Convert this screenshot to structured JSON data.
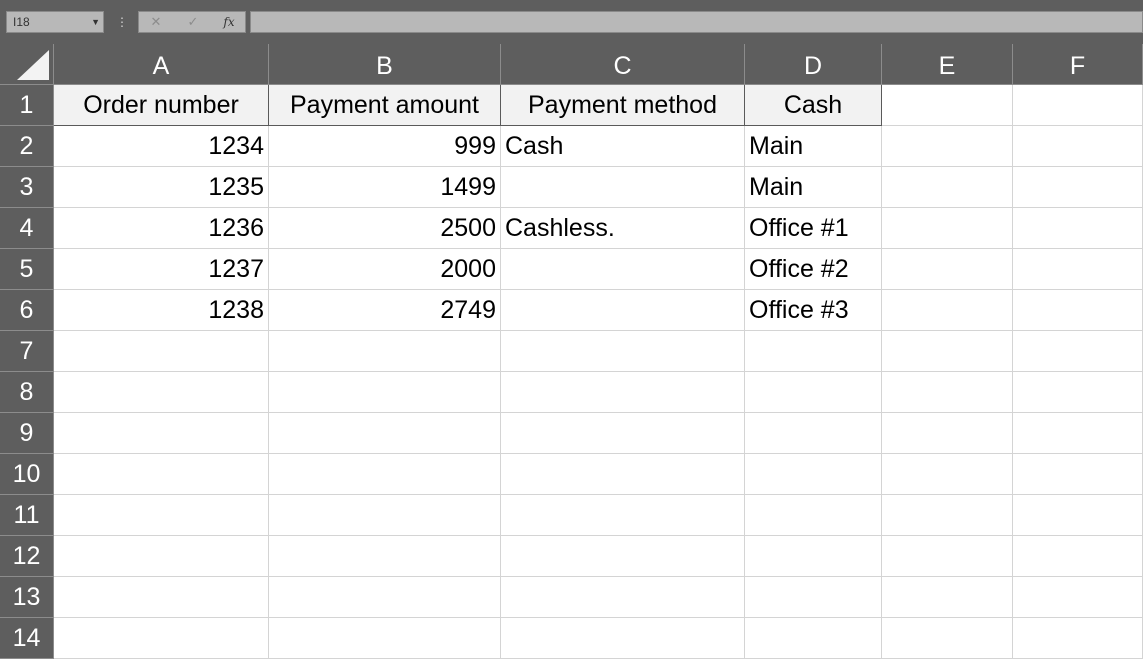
{
  "formula_bar": {
    "name_box": "I18",
    "cancel_icon": "cancel-icon",
    "enter_icon": "enter-icon",
    "fx_label": "fx",
    "formula_value": ""
  },
  "columns": [
    "A",
    "B",
    "C",
    "D",
    "E",
    "F"
  ],
  "rows": [
    "1",
    "2",
    "3",
    "4",
    "5",
    "6",
    "7",
    "8",
    "9",
    "10",
    "11",
    "12",
    "13",
    "14"
  ],
  "sheet": {
    "cells": [
      [
        "Order number",
        "Payment amount",
        "Payment method",
        "Cash",
        "",
        ""
      ],
      [
        "1234",
        "999",
        "Cash",
        "Main",
        "",
        ""
      ],
      [
        "1235",
        "1499",
        "",
        "Main",
        "",
        ""
      ],
      [
        "1236",
        "2500",
        "Cashless.",
        "Office #1",
        "",
        ""
      ],
      [
        "1237",
        "2000",
        "",
        "Office #2",
        "",
        ""
      ],
      [
        "1238",
        "2749",
        "",
        "Office #3",
        "",
        ""
      ]
    ]
  },
  "colors": {
    "header_bg": "#5e5e5e",
    "header_text": "#ffffff",
    "table_header_fill": "#f2f2f2",
    "gridline": "#d4d4d4"
  }
}
